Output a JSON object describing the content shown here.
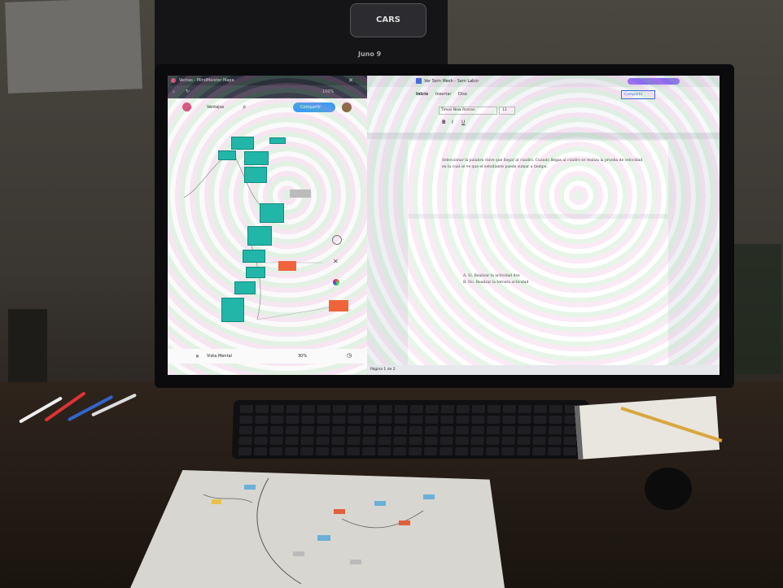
{
  "poster": {
    "logo_label": "CARS",
    "caption": "Juno 9"
  },
  "mindmap_app": {
    "window_title": "Ventas - MindMeister Mapa",
    "toolbar_zoom": "100%",
    "map_title": "Ventajas",
    "share_button": "Compartir",
    "footer_label": "Vista Mental",
    "footer_zoom": "30%"
  },
  "doc_app": {
    "tab_title": "Ver Sem Mesh - Sem Labor",
    "ribbon_tabs": [
      "Inicio",
      "Insertar",
      "Dise"
    ],
    "font_name": "Times New Roman",
    "font_size": "12",
    "share_button": "Compartir",
    "body_line_1": "Seleccionar la palabra clave que llegar al cuadro. Cuando llegas al cuadro se realiza la prueba de velocidad",
    "body_line_2": "en la cual se ve que el estudiante puede sumar a tiempo.",
    "item_1": "A. Sí. Realizar la actividad dos",
    "item_2": "B. No. Realizar la tercera actividad",
    "status_left": "Página 1 de 2"
  },
  "colors": {
    "node_teal": "#21b6a8",
    "node_orange": "#f0643c",
    "accent_pink": "#e8447a",
    "share_blue": "#3b9cf0"
  }
}
